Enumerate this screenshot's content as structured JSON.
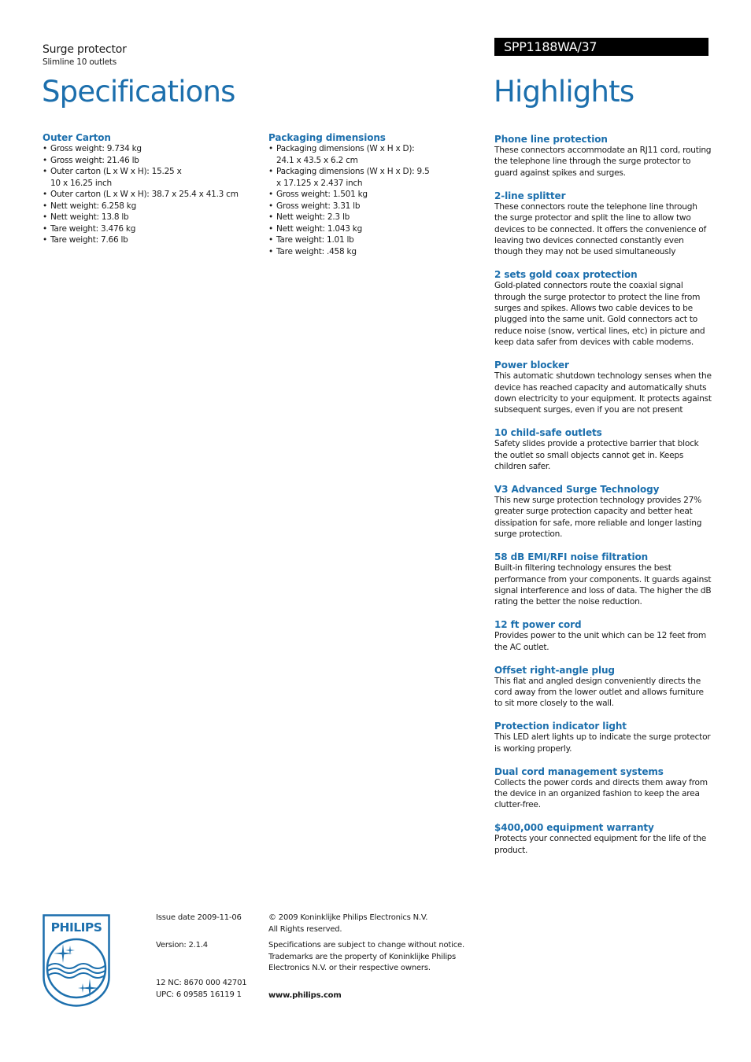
{
  "header": {
    "product_name": "Surge protector",
    "product_subtitle": "Slimline 10 outlets",
    "model_number": "SPP1188WA/37",
    "specifications_title": "Specifications",
    "highlights_title": "Highlights"
  },
  "colors": {
    "accent": "#1c6fad",
    "model_bar_bg": "#000000",
    "text": "#1a1a1a"
  },
  "specifications": [
    {
      "heading": "Outer Carton",
      "items": [
        "Gross weight: 9.734 kg",
        "Gross weight: 21.46 lb",
        "Outer carton (L x W x H): 15.25 x 10 x 16.25 inch",
        "Outer carton (L x W x H): 38.7 x 25.4 x 41.3 cm",
        "Nett weight: 6.258 kg",
        "Nett weight: 13.8 lb",
        "Tare weight: 3.476 kg",
        "Tare weight: 7.66 lb"
      ]
    },
    {
      "heading": "Packaging dimensions",
      "items": [
        "Packaging dimensions (W x H x D): 24.1 x 43.5 x 6.2 cm",
        "Packaging dimensions (W x H x D): 9.5 x 17.125 x 2.437 inch",
        "Gross weight: 1.501 kg",
        "Gross weight: 3.31 lb",
        "Nett weight: 2.3 lb",
        "Nett weight: 1.043 kg",
        "Tare weight: 1.01 lb",
        "Tare weight: .458 kg"
      ]
    }
  ],
  "highlights": [
    {
      "title": "Phone line protection",
      "body": "These connectors accommodate an RJ11 cord, routing the telephone line through the surge protector to guard against spikes and surges."
    },
    {
      "title": "2-line splitter",
      "body": "These connectors route the telephone line through the surge protector and split the line to allow two devices to be connected. It offers the convenience of leaving two devices connected constantly even though they may not be used simultaneously"
    },
    {
      "title": "2 sets gold coax protection",
      "body": "Gold-plated connectors route the coaxial signal through the surge protector to protect the line from surges and spikes. Allows two cable devices to be plugged into the same unit. Gold connectors act to reduce noise (snow, vertical lines, etc) in picture and keep data safer from devices with cable modems."
    },
    {
      "title": "Power blocker",
      "body": "This automatic shutdown technology senses when the device has reached capacity and automatically shuts down electricity to your equipment. It protects against subsequent surges, even if you are not present"
    },
    {
      "title": "10 child-safe outlets",
      "body": "Safety slides provide a protective barrier that block the outlet so small objects cannot get in. Keeps children safer."
    },
    {
      "title": "V3 Advanced Surge Technology",
      "body": "This new surge protection technology provides 27% greater surge protection capacity and better heat dissipation for safe, more reliable and longer lasting surge protection."
    },
    {
      "title": "58 dB EMI/RFI noise filtration",
      "body": "Built-in filtering technology ensures the best performance from your components. It guards against signal interference and loss of data. The higher the dB rating the better the noise reduction."
    },
    {
      "title": "12 ft power cord",
      "body": "Provides power to the unit which can be 12 feet from the AC outlet."
    },
    {
      "title": "Offset right-angle plug",
      "body": "This flat and angled design conveniently directs the cord away from the lower outlet and allows furniture to sit more closely to the wall."
    },
    {
      "title": "Protection indicator light",
      "body": "This LED alert lights up to indicate the surge protector is working properly."
    },
    {
      "title": "Dual cord management systems",
      "body": "Collects the power cords and directs them away from the device in an organized fashion to keep the area clutter-free."
    },
    {
      "title": "$400,000 equipment warranty",
      "body": "Protects your connected equipment for the life of the product."
    }
  ],
  "footer": {
    "logo_text": "PHILIPS",
    "issue_date": "Issue date 2009-11-06",
    "version": "Version: 2.1.4",
    "nc": "12 NC: 8670 000 42701",
    "upc": "UPC: 6 09585 16119 1",
    "copyright_line1": "© 2009 Koninklijke Philips Electronics N.V.",
    "copyright_line2": "All Rights reserved.",
    "disclaimer_line1": "Specifications are subject to change without notice.",
    "disclaimer_line2": "Trademarks are the property of Koninklijke Philips",
    "disclaimer_line3": "Electronics N.V. or their respective owners.",
    "website": "www.philips.com"
  }
}
